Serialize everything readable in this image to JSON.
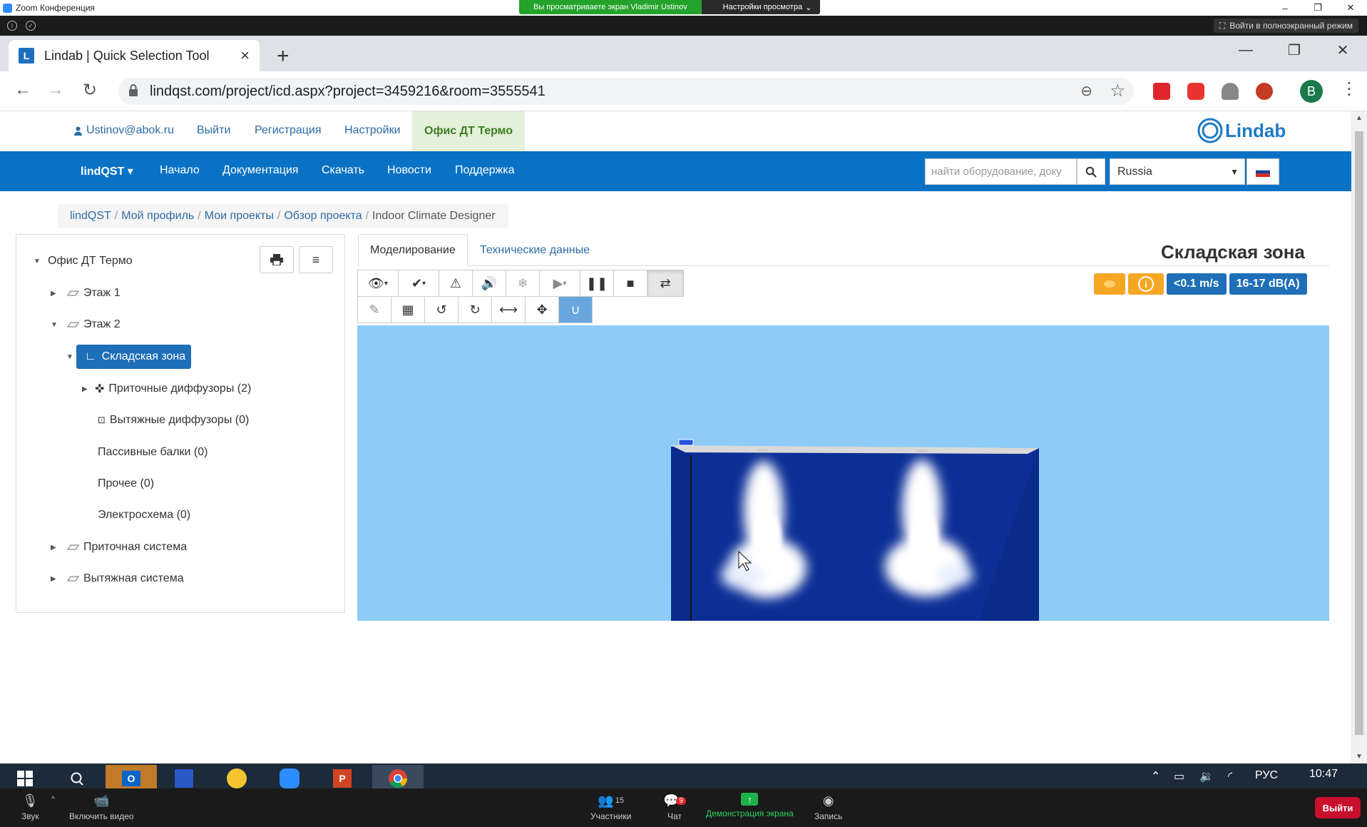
{
  "zoom": {
    "window_title": "Zoom Конференция",
    "share_banner": "Вы просматриваете экран Vladimir Ustinov",
    "view_settings": "Настройки просмотра",
    "fullscreen": "Войти в полноэкранный режим",
    "bottom": {
      "audio": "Звук",
      "video": "Включить видео",
      "participants": "Участники",
      "participants_count": "15",
      "chat": "Чат",
      "chat_badge": "9",
      "share": "Демонстрация экрана",
      "record": "Запись",
      "leave": "Выйти"
    }
  },
  "browser": {
    "tab_title": "Lindab | Quick Selection Tool",
    "favicon_letter": "L",
    "url": "lindqst.com/project/icd.aspx?project=3459216&room=3555541",
    "profile_letter": "B"
  },
  "site": {
    "user_email": "Ustinov@abok.ru",
    "top_links": [
      "Выйти",
      "Регистрация",
      "Настройки"
    ],
    "active_project": "Офис ДТ Термо",
    "logo_text": "Lindab",
    "nav": [
      "lindQST",
      "Начало",
      "Документация",
      "Скачать",
      "Новости",
      "Поддержка"
    ],
    "search_placeholder": "найти оборудование, доку",
    "country": "Russia",
    "breadcrumb": [
      "lindQST",
      "Мой профиль",
      "Мои проекты",
      "Обзор проекта"
    ],
    "breadcrumb_current": "Indoor Climate Designer"
  },
  "tree": {
    "root": "Офис ДТ Термо",
    "floor1": "Этаж 1",
    "floor2": "Этаж 2",
    "zone": "Складская зона",
    "supply_diffusers": "Приточные диффузоры (2)",
    "exhaust_diffusers": "Вытяжные диффузоры (0)",
    "passive_beams": "Пассивные балки (0)",
    "other": "Прочее (0)",
    "electrical": "Электросхема (0)",
    "supply_system": "Приточная система",
    "exhaust_system": "Вытяжная система"
  },
  "main": {
    "tabs": [
      "Моделирование",
      "Технические данные"
    ],
    "zone_title": "Складская зона",
    "badge_velocity": "<0.1 m/s",
    "badge_sound": "16-17 dB(A)",
    "colors": {
      "orange": "#f5a623",
      "blue": "#1e6fb8",
      "viewport_bg": "#8ecbf7",
      "room_wall": "#0c2f96"
    }
  },
  "taskbar": {
    "language": "РУС",
    "time": "10:47"
  }
}
